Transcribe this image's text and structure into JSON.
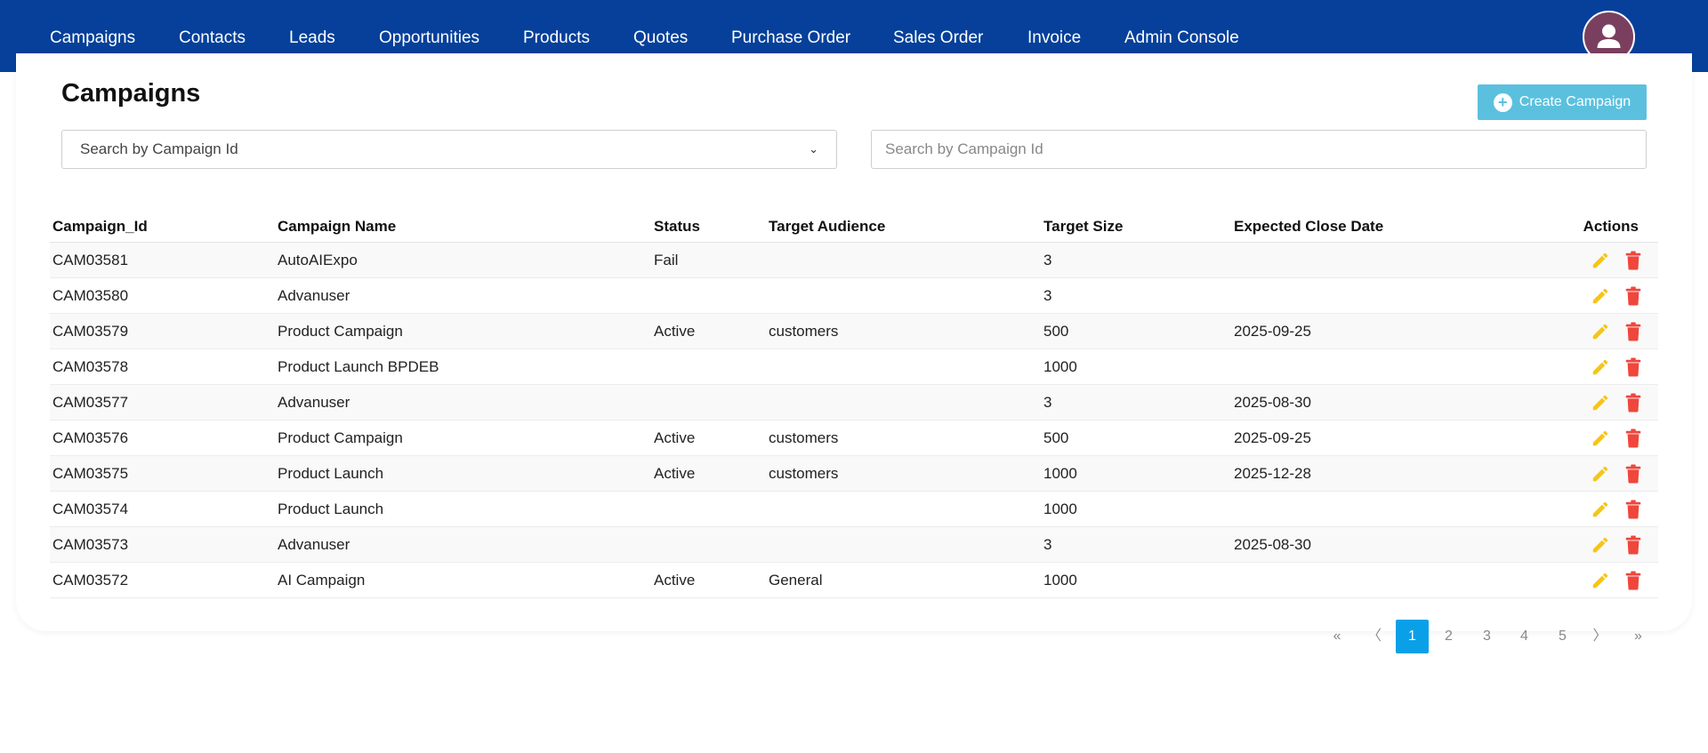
{
  "nav": {
    "items": [
      "Campaigns",
      "Contacts",
      "Leads",
      "Opportunities",
      "Products",
      "Quotes",
      "Purchase Order",
      "Sales Order",
      "Invoice",
      "Admin Console"
    ],
    "avatar_icon": "user-icon"
  },
  "page": {
    "title": "Campaigns",
    "create_button": "Create Campaign",
    "create_icon": "plus-circle-icon"
  },
  "filters": {
    "select_value": "Search by Campaign Id",
    "search_placeholder": "Search by Campaign Id"
  },
  "table": {
    "columns": [
      "Campaign_Id",
      "Campaign Name",
      "Status",
      "Target Audience",
      "Target Size",
      "Expected Close Date",
      "Actions"
    ],
    "rows": [
      {
        "id": "CAM03581",
        "name": "AutoAIExpo",
        "status": "Fail",
        "audience": "",
        "size": "3",
        "close": ""
      },
      {
        "id": "CAM03580",
        "name": "Advanuser",
        "status": "",
        "audience": "",
        "size": "3",
        "close": ""
      },
      {
        "id": "CAM03579",
        "name": "Product Campaign",
        "status": "Active",
        "audience": "customers",
        "size": "500",
        "close": "2025-09-25"
      },
      {
        "id": "CAM03578",
        "name": "Product Launch BPDEB",
        "status": "",
        "audience": "",
        "size": "1000",
        "close": ""
      },
      {
        "id": "CAM03577",
        "name": "Advanuser",
        "status": "",
        "audience": "",
        "size": "3",
        "close": "2025-08-30"
      },
      {
        "id": "CAM03576",
        "name": "Product Campaign",
        "status": "Active",
        "audience": "customers",
        "size": "500",
        "close": "2025-09-25"
      },
      {
        "id": "CAM03575",
        "name": "Product Launch",
        "status": "Active",
        "audience": "customers",
        "size": "1000",
        "close": "2025-12-28"
      },
      {
        "id": "CAM03574",
        "name": "Product Launch",
        "status": "",
        "audience": "",
        "size": "1000",
        "close": ""
      },
      {
        "id": "CAM03573",
        "name": "Advanuser",
        "status": "",
        "audience": "",
        "size": "3",
        "close": "2025-08-30"
      },
      {
        "id": "CAM03572",
        "name": "AI Campaign",
        "status": "Active",
        "audience": "General",
        "size": "1000",
        "close": ""
      }
    ],
    "edit_icon": "pencil-icon",
    "delete_icon": "trash-icon",
    "edit_color": "#f5c518",
    "delete_color": "#f0463c"
  },
  "pagination": {
    "first": "«",
    "prev": "〈",
    "pages": [
      "1",
      "2",
      "3",
      "4",
      "5"
    ],
    "active_page": "1",
    "next": "〉",
    "last": "»"
  },
  "colors": {
    "navbar": "#06409a",
    "create_button": "#5bc0de",
    "active_page": "#0aa0e8",
    "avatar": "#7a3f5f"
  }
}
